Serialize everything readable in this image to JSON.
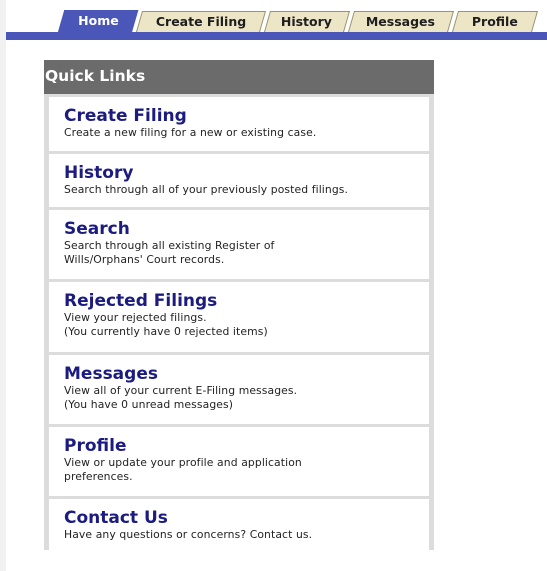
{
  "tabs": [
    {
      "label": "Home",
      "active": true
    },
    {
      "label": "Create Filing",
      "active": false
    },
    {
      "label": "History",
      "active": false
    },
    {
      "label": "Messages",
      "active": false
    },
    {
      "label": "Profile",
      "active": false
    }
  ],
  "quick_links": {
    "header": "Quick Links",
    "items": [
      {
        "title": "Create Filing",
        "description": [
          "Create a new filing for a new or existing case."
        ]
      },
      {
        "title": "History",
        "description": [
          "Search through all of your previously posted filings."
        ]
      },
      {
        "title": "Search",
        "description": [
          "Search through all existing Register of",
          "Wills/Orphans' Court records."
        ]
      },
      {
        "title": "Rejected Filings",
        "description": [
          "View your rejected filings.",
          "(You currently have 0 rejected items)"
        ]
      },
      {
        "title": "Messages",
        "description": [
          "View all of your current E-Filing messages.",
          "(You have 0 unread messages)"
        ]
      },
      {
        "title": "Profile",
        "description": [
          "View or update your profile and application",
          "preferences."
        ]
      },
      {
        "title": "Contact Us",
        "description": [
          "Have any questions or concerns? Contact us."
        ]
      }
    ]
  },
  "colors": {
    "tab_active": "#4a57b8",
    "tab_inactive": "#ece6c7",
    "link_title": "#1b1b80",
    "header_bg": "#6b6b6b"
  }
}
